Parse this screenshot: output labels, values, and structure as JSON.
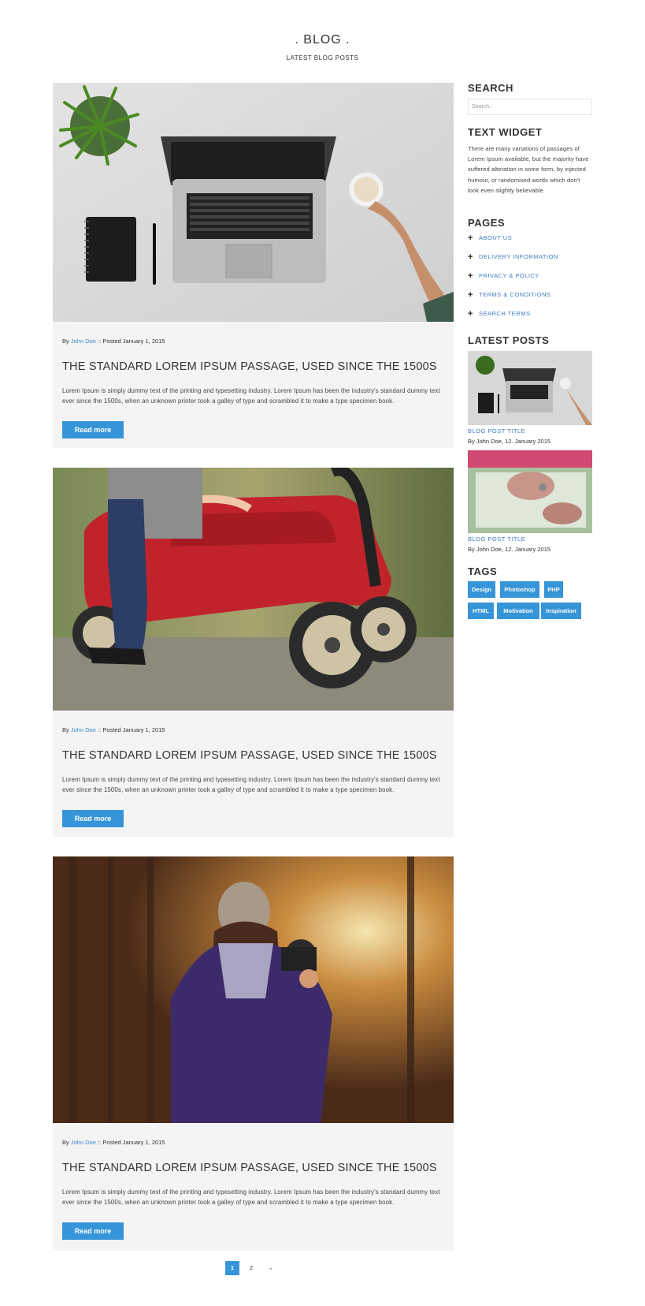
{
  "header": {
    "title": ". BLOG .",
    "subtitle": "LATEST BLOG POSTS"
  },
  "posts": [
    {
      "image_alt": "laptop",
      "meta_prefix": "By",
      "author": "John Doe",
      "meta_suffix": ":: Posted January 1, 2015",
      "title": "THE STANDARD LOREM IPSUM PASSAGE, USED SINCE THE 1500S",
      "excerpt": "Lorem Ipsum is simply dummy text of the printing and typesetting industry. Lorem Ipsum has been the industry's standard dummy text ever since the 1500s, when an unknown printer took a galley of type and scrambled it to make a type specimen book.",
      "button": "Read more"
    },
    {
      "image_alt": "wagon",
      "meta_prefix": "By",
      "author": "John Doe",
      "meta_suffix": ":: Posted January 1, 2015",
      "title": "THE STANDARD LOREM IPSUM PASSAGE, USED SINCE THE 1500S",
      "excerpt": "Lorem Ipsum is simply dummy text of the printing and typesetting industry. Lorem Ipsum has been the industry's standard dummy text ever since the 1500s, when an unknown printer took a galley of type and scrambled it to make a type specimen book.",
      "button": "Read more"
    },
    {
      "image_alt": "photographer",
      "meta_prefix": "By",
      "author": "John Doe",
      "meta_suffix": ":: Posted January 1, 2015",
      "title": "THE STANDARD LOREM IPSUM PASSAGE, USED SINCE THE 1500S",
      "excerpt": "Lorem Ipsum is simply dummy text of the printing and typesetting industry. Lorem Ipsum has been the industry's standard dummy text ever since the 1500s, when an unknown printer took a galley of type and scrambled it to make a type specimen book.",
      "button": "Read more"
    }
  ],
  "sidebar": {
    "search": {
      "title": "SEARCH",
      "placeholder": "Search.."
    },
    "text_widget": {
      "title": "TEXT WIDGET",
      "text": "There are many variations of passages of Lorem Ipsum available, but the majority have suffered alteration in some form, by injected humour, or randomised words which don't look even slightly believable."
    },
    "pages": {
      "title": "PAGES",
      "items": [
        "ABOUT US",
        "DELIVERY INFORMATION",
        "PRIVACY & POLICY",
        "TERMS & CONDITIONS",
        "SEARCH TERMS"
      ]
    },
    "latest_posts": {
      "title": "LATEST POSTS",
      "items": [
        {
          "title": "BLOG POST TITLE",
          "meta": "By John Doe, 12. January 2015"
        },
        {
          "title": "BLOG POST TITLE",
          "meta": "By John Doe, 12. January 2015"
        }
      ]
    },
    "tags": {
      "title": "TAGS",
      "items": [
        "Design",
        "Photoshop",
        "PHP",
        "HTML",
        "Motivation",
        "Inspiration"
      ]
    }
  },
  "pagination": {
    "pages": [
      "1",
      "2"
    ],
    "next": "→",
    "current": "1"
  },
  "colors": {
    "accent": "#3695d8",
    "link": "#3a7cc0",
    "post_bg": "#f4f4f4"
  }
}
